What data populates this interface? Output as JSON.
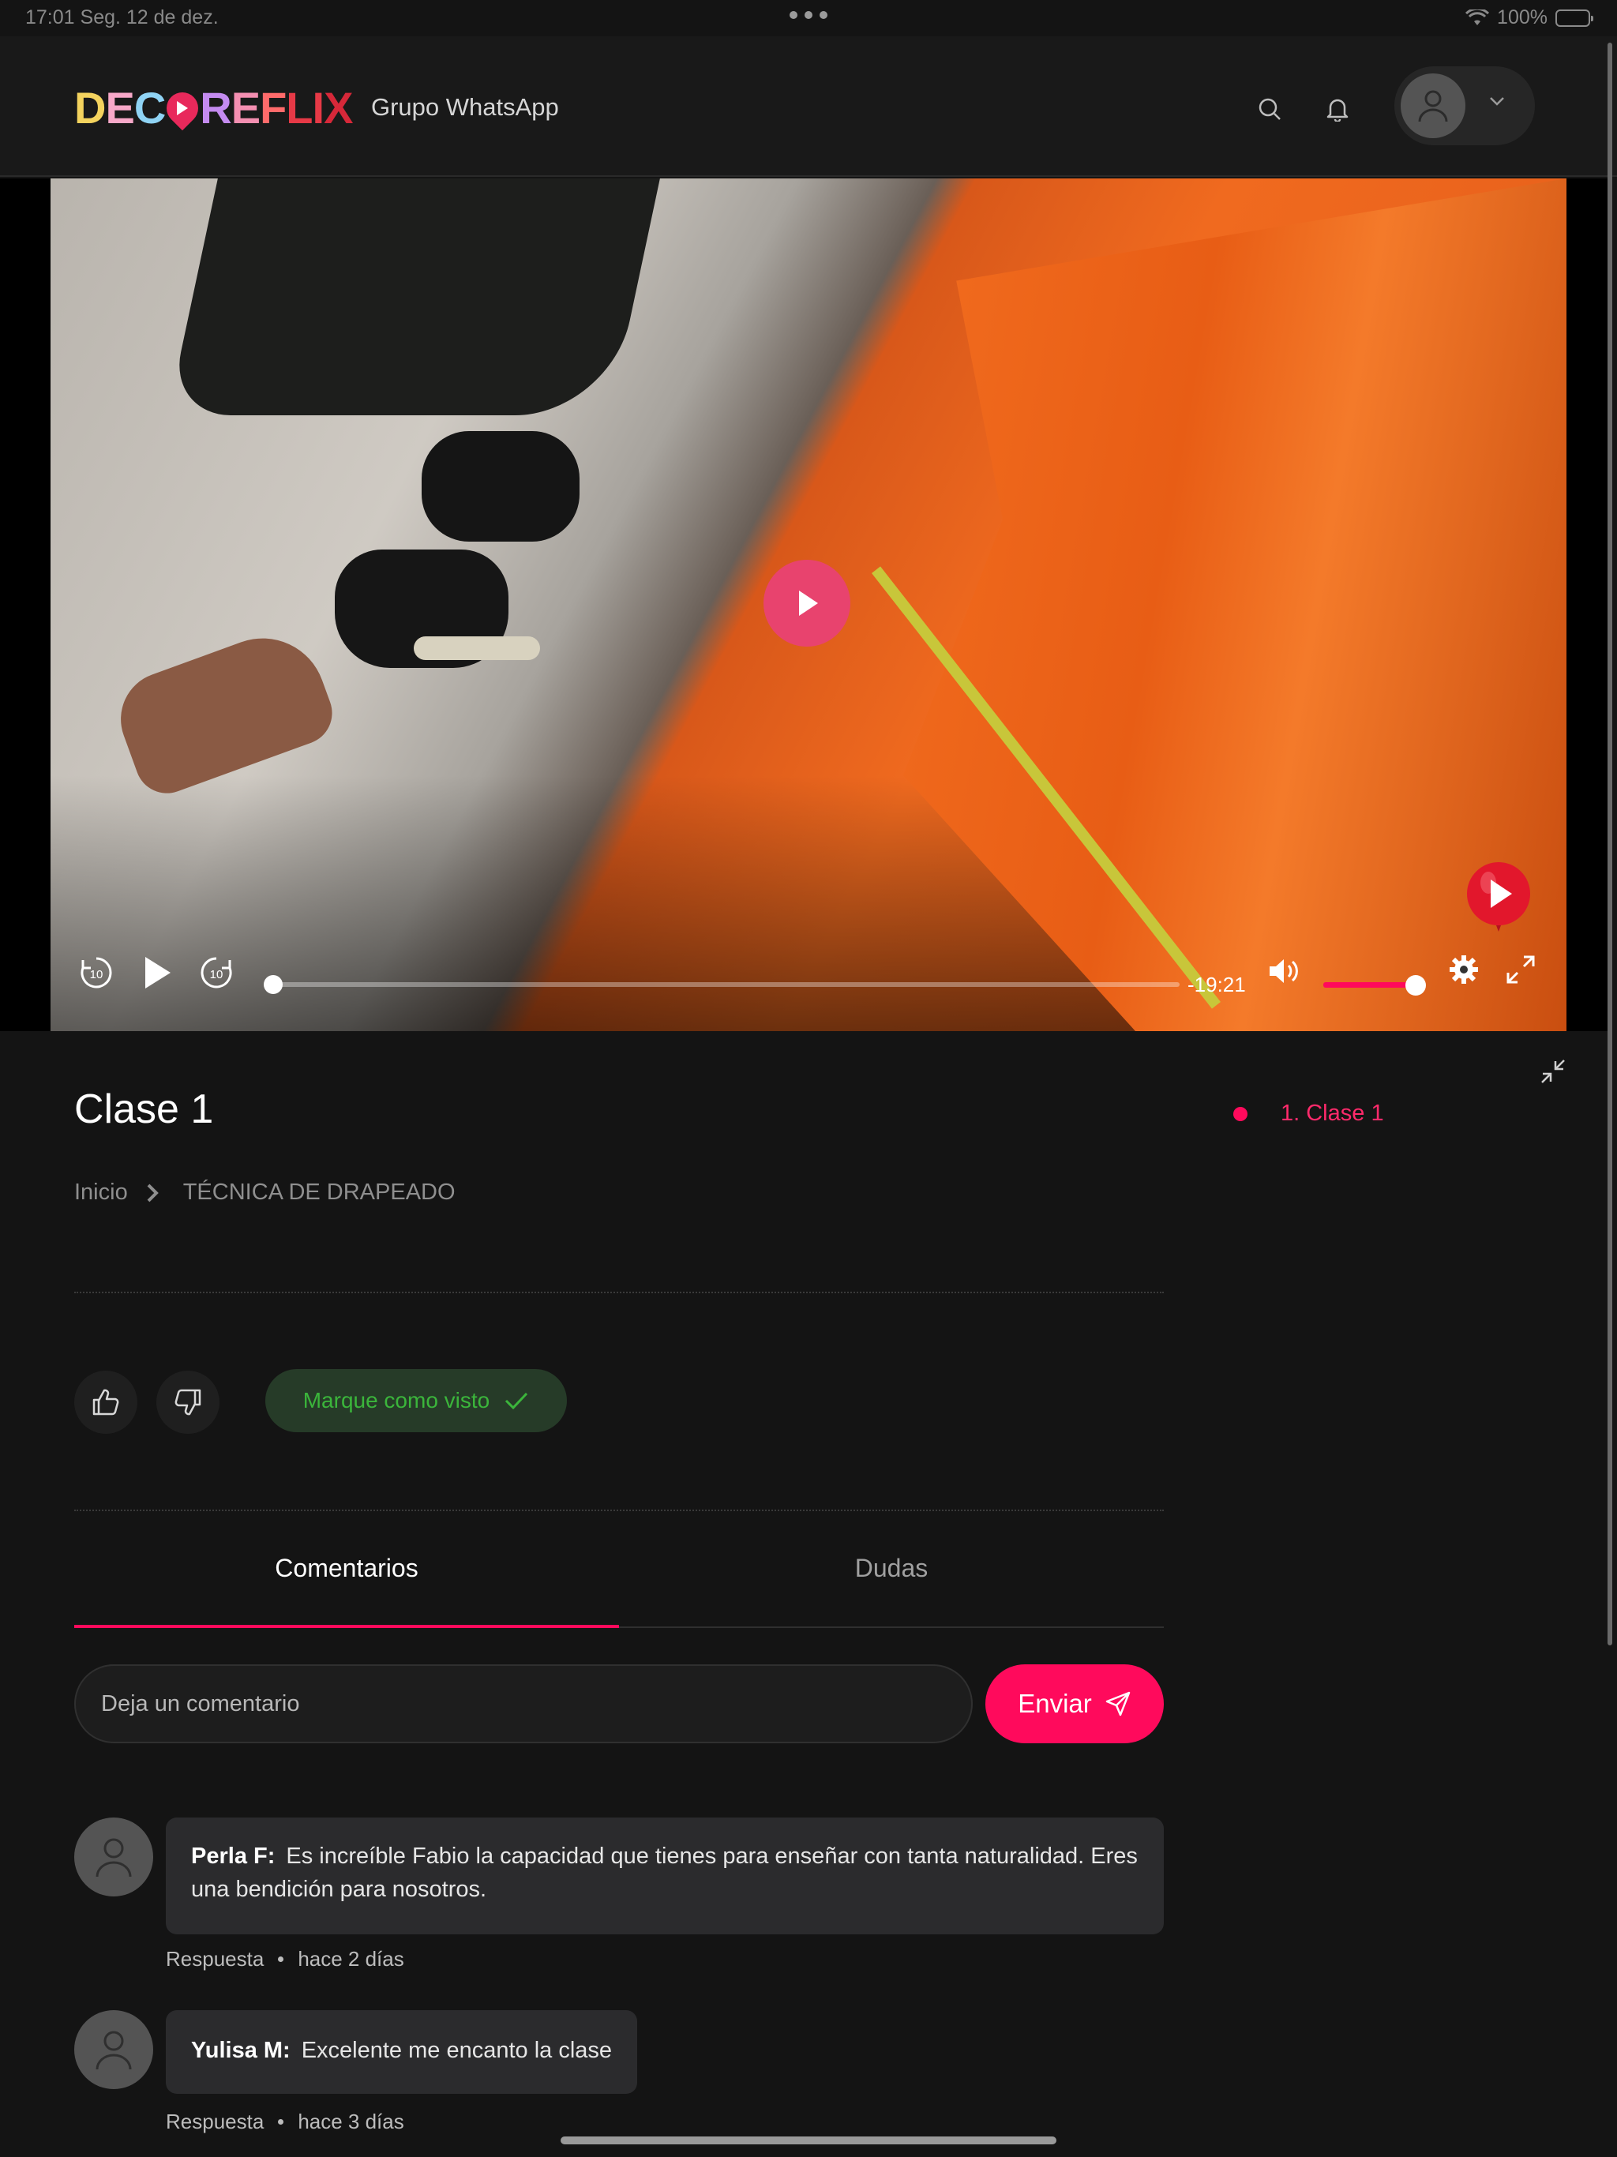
{
  "status_bar": {
    "time": "17:01",
    "date": "Seg. 12 de dez.",
    "battery": "100%"
  },
  "header": {
    "logo_text": "DECOREFLIX",
    "nav_link": "Grupo WhatsApp"
  },
  "player": {
    "time_remaining": "-19:21",
    "progress": 0.0,
    "volume": 1.0,
    "skip_back_label": "10",
    "skip_forward_label": "10"
  },
  "lesson": {
    "title": "Clase 1",
    "breadcrumb": {
      "home": "Inicio",
      "course": "TÉCNICA DE DRAPEADO"
    },
    "mark_watched": "Marque como visto"
  },
  "playlist": [
    {
      "label": "1. Clase 1"
    }
  ],
  "tabs": [
    {
      "label": "Comentarios",
      "active": true
    },
    {
      "label": "Dudas",
      "active": false
    }
  ],
  "comment_form": {
    "placeholder": "Deja un comentario",
    "send_label": "Enviar"
  },
  "comments": [
    {
      "author": "Perla F:",
      "text": "Es increíble Fabio la capacidad que tienes para enseñar con tanta naturalidad. Eres una bendición para nosotros.",
      "reply_label": "Respuesta",
      "time": "hace 2 días"
    },
    {
      "author": "Yulisa M:",
      "text": "Excelente me encanto la clase",
      "reply_label": "Respuesta",
      "time": "hace 3 días"
    }
  ],
  "colors": {
    "accent": "#ff0a5c",
    "watched_green": "#3bb53b",
    "background": "#141414"
  }
}
